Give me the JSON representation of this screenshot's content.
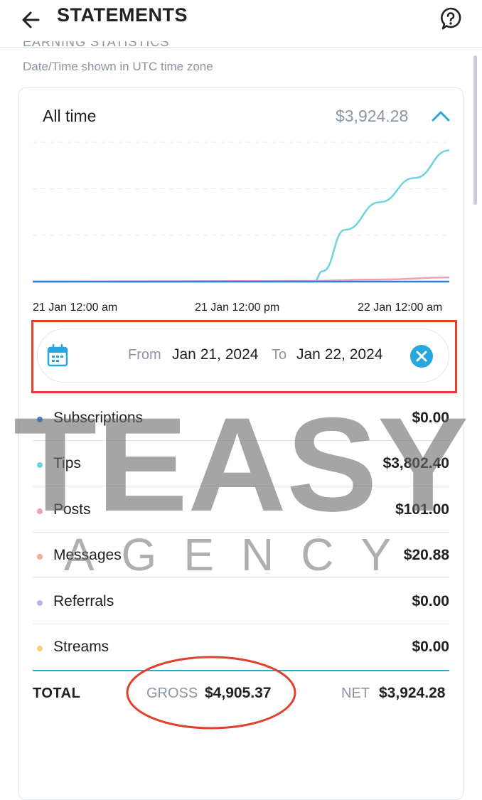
{
  "header": {
    "title": "STATEMENTS"
  },
  "section": {
    "heading": "EARNING STATISTICS",
    "timezone_note": "Date/Time shown in UTC time zone"
  },
  "summary": {
    "period": "All time",
    "total": "$3,924.28"
  },
  "chart_data": {
    "type": "line",
    "x": [
      "21 Jan 12:00 am",
      "21 Jan 12:00 pm",
      "22 Jan 12:00 am"
    ],
    "series": [
      {
        "color": "#6fd3dc",
        "x_hours": [
          0,
          16.2,
          16.7,
          18,
          20,
          22,
          24
        ],
        "values": [
          0,
          0,
          300,
          1500,
          2300,
          3000,
          3802
        ]
      },
      {
        "color": "#f2a0b6",
        "x_hours": [
          0,
          16,
          20,
          24
        ],
        "values": [
          0,
          20,
          60,
          120
        ]
      },
      {
        "color": "#2f7fdc",
        "x_hours": [
          0,
          24
        ],
        "values": [
          0,
          0
        ]
      }
    ],
    "ylim": [
      0,
      4200
    ],
    "grid": true
  },
  "date_range": {
    "from_label": "From",
    "from_value": "Jan 21, 2024",
    "to_label": "To",
    "to_value": "Jan 22, 2024"
  },
  "categories": [
    {
      "label": "Subscriptions",
      "value": "$0.00",
      "color": "#2f7fdc"
    },
    {
      "label": "Tips",
      "value": "$3,802.40",
      "color": "#6fd3dc"
    },
    {
      "label": "Posts",
      "value": "$101.00",
      "color": "#f2a0b6"
    },
    {
      "label": "Messages",
      "value": "$20.88",
      "color": "#f3a896"
    },
    {
      "label": "Referrals",
      "value": "$0.00",
      "color": "#b9b2e0"
    },
    {
      "label": "Streams",
      "value": "$0.00",
      "color": "#f6cf7a"
    }
  ],
  "totals": {
    "label": "TOTAL",
    "gross_label": "GROSS",
    "gross_value": "$4,905.37",
    "net_label": "NET",
    "net_value": "$3,924.28"
  },
  "watermark": {
    "line1": "TEASY",
    "line2": "AGENCY"
  },
  "colors": {
    "accent": "#27a7dd",
    "annotation": "#e0402c",
    "muted_text": "#8a96a3"
  }
}
